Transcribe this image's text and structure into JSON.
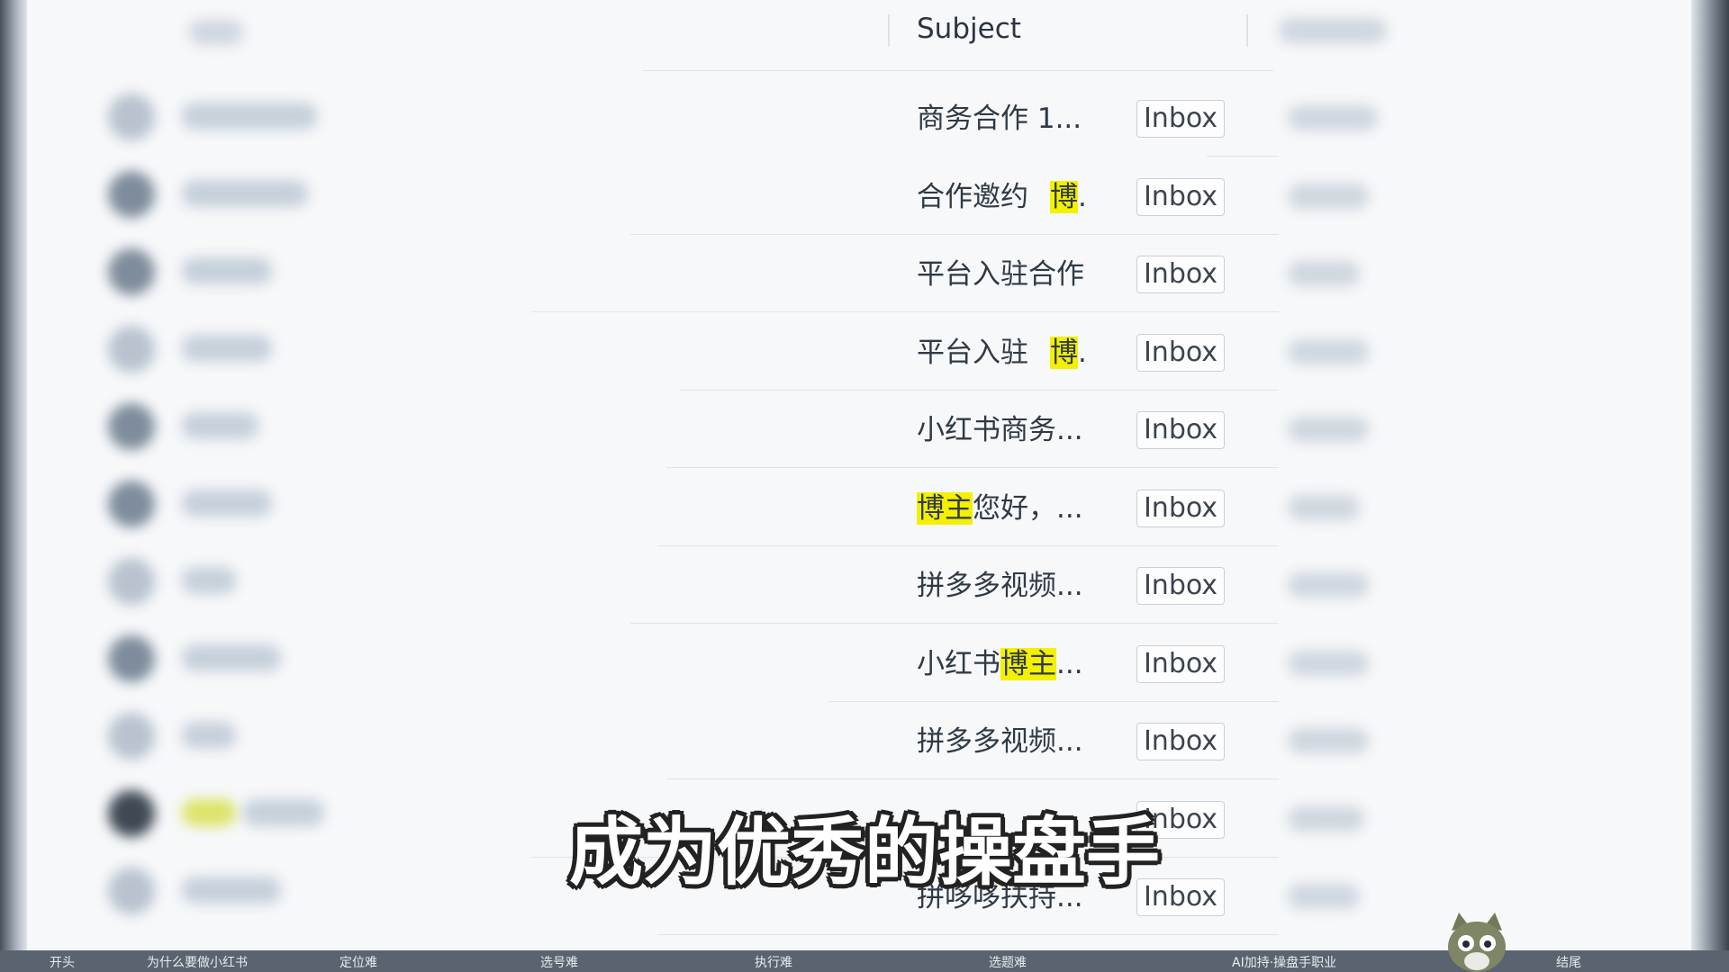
{
  "table": {
    "header": "Subject",
    "rows": [
      {
        "pre": "商务合作",
        "mark": "",
        "post": "   1...",
        "tag": "Inbox"
      },
      {
        "pre": "合作邀约",
        "mark": "",
        "post": "",
        "tag": "Inbox",
        "mark_tail": "博",
        "tail_after": "."
      },
      {
        "pre": "平台入驻合作",
        "mark": "",
        "post": "",
        "tag": "Inbox"
      },
      {
        "pre": "平台入驻",
        "mark": "",
        "post": "",
        "tag": "Inbox",
        "mark_tail": "博",
        "tail_after": "."
      },
      {
        "pre": "小红书商务...",
        "mark": "",
        "post": "",
        "tag": "Inbox"
      },
      {
        "pre": "",
        "mark": "博主",
        "post": "您好，...",
        "tag": "Inbox"
      },
      {
        "pre": "拼多多视频...",
        "mark": "",
        "post": "",
        "tag": "Inbox"
      },
      {
        "pre": "小红书",
        "mark": "博主",
        "post": "...",
        "tag": "Inbox"
      },
      {
        "pre": "拼多多视频...",
        "mark": "",
        "post": "",
        "tag": "Inbox"
      },
      {
        "pre": "",
        "mark": "",
        "post": "",
        "tag": "Inbox"
      },
      {
        "pre": "拼哆哆扶持...",
        "mark": "",
        "post": "",
        "tag": "Inbox"
      }
    ]
  },
  "subtitle": "成为优秀的操盘手",
  "bottom_bar": [
    "开头",
    "为什么要做小红书",
    "定位难",
    "选号难",
    "执行难",
    "选题难",
    "AI加持·操盘手职业",
    "结尾"
  ],
  "colors": {
    "highlight": "#f3f000",
    "background": "#f6f8fa"
  }
}
